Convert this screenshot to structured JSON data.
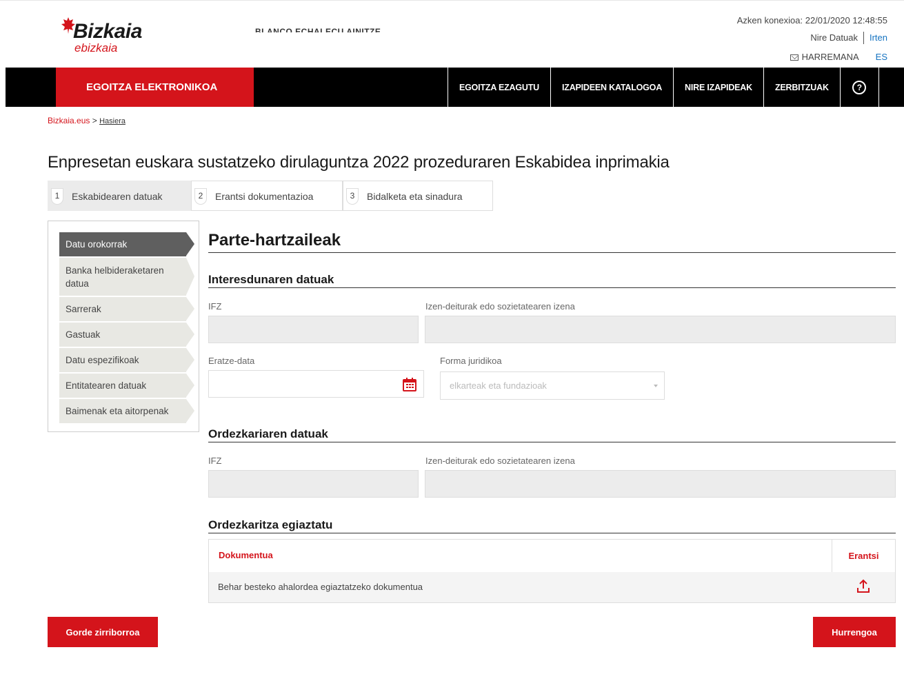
{
  "header": {
    "logo_name": "Bizkaia",
    "logo_sub": "ebizkaia",
    "username": "BLANCO ECHALECU AINITZE",
    "last_connection": "Azken konexioa: 22/01/2020 12:48:55",
    "my_data": "Nire Datuak",
    "logout": "Irten",
    "contact": "HARREMANA",
    "language": "ES"
  },
  "navbar": {
    "brand": "EGOITZA ELEKTRONIKOA",
    "items": [
      "EGOITZA EZAGUTU",
      "IZAPIDEEN KATALOGOA",
      "NIRE IZAPIDEAK",
      "ZERBITZUAK"
    ],
    "help": "?"
  },
  "breadcrumb": {
    "home": "Bizkaia.eus",
    "separator": ">",
    "current": "Hasiera"
  },
  "page_title": "Enpresetan euskara sustatzeko dirulaguntza 2022 prozeduraren Eskabidea inprimakia",
  "steps": [
    {
      "num": "1",
      "label": "Eskabidearen datuak",
      "active": true
    },
    {
      "num": "2",
      "label": "Erantsi dokumentazioa",
      "active": false
    },
    {
      "num": "3",
      "label": "Bidalketa eta sinadura",
      "active": false
    }
  ],
  "sidebar": {
    "items": [
      "Datu orokorrak",
      "Banka helbideraketaren datua",
      "Sarrerak",
      "Gastuak",
      "Datu espezifikoak",
      "Entitatearen datuak",
      "Baimenak eta aitorpenak"
    ],
    "active_index": 0
  },
  "main": {
    "section_title": "Parte-hartzaileak",
    "interested": {
      "title": "Interesdunaren datuak",
      "ifz_label": "IFZ",
      "name_label": "Izen-deiturak edo sozietatearen izena",
      "date_label": "Eratze-data",
      "legal_form_label": "Forma juridikoa",
      "legal_form_value": "elkarteak eta fundazioak"
    },
    "representative": {
      "title": "Ordezkariaren datuak",
      "ifz_label": "IFZ",
      "name_label": "Izen-deiturak edo sozietatearen izena"
    },
    "verify": {
      "title": "Ordezkaritza egiaztatu",
      "col_document": "Dokumentua",
      "col_attach": "Erantsi",
      "row_document": "Behar besteko ahalordea egiaztatzeko dokumentua"
    }
  },
  "buttons": {
    "save_draft": "Gorde zirriborroa",
    "next": "Hurrengoa"
  },
  "colors": {
    "brand_red": "#d4141b",
    "link_blue": "#1573c1",
    "nav_black": "#000000"
  }
}
